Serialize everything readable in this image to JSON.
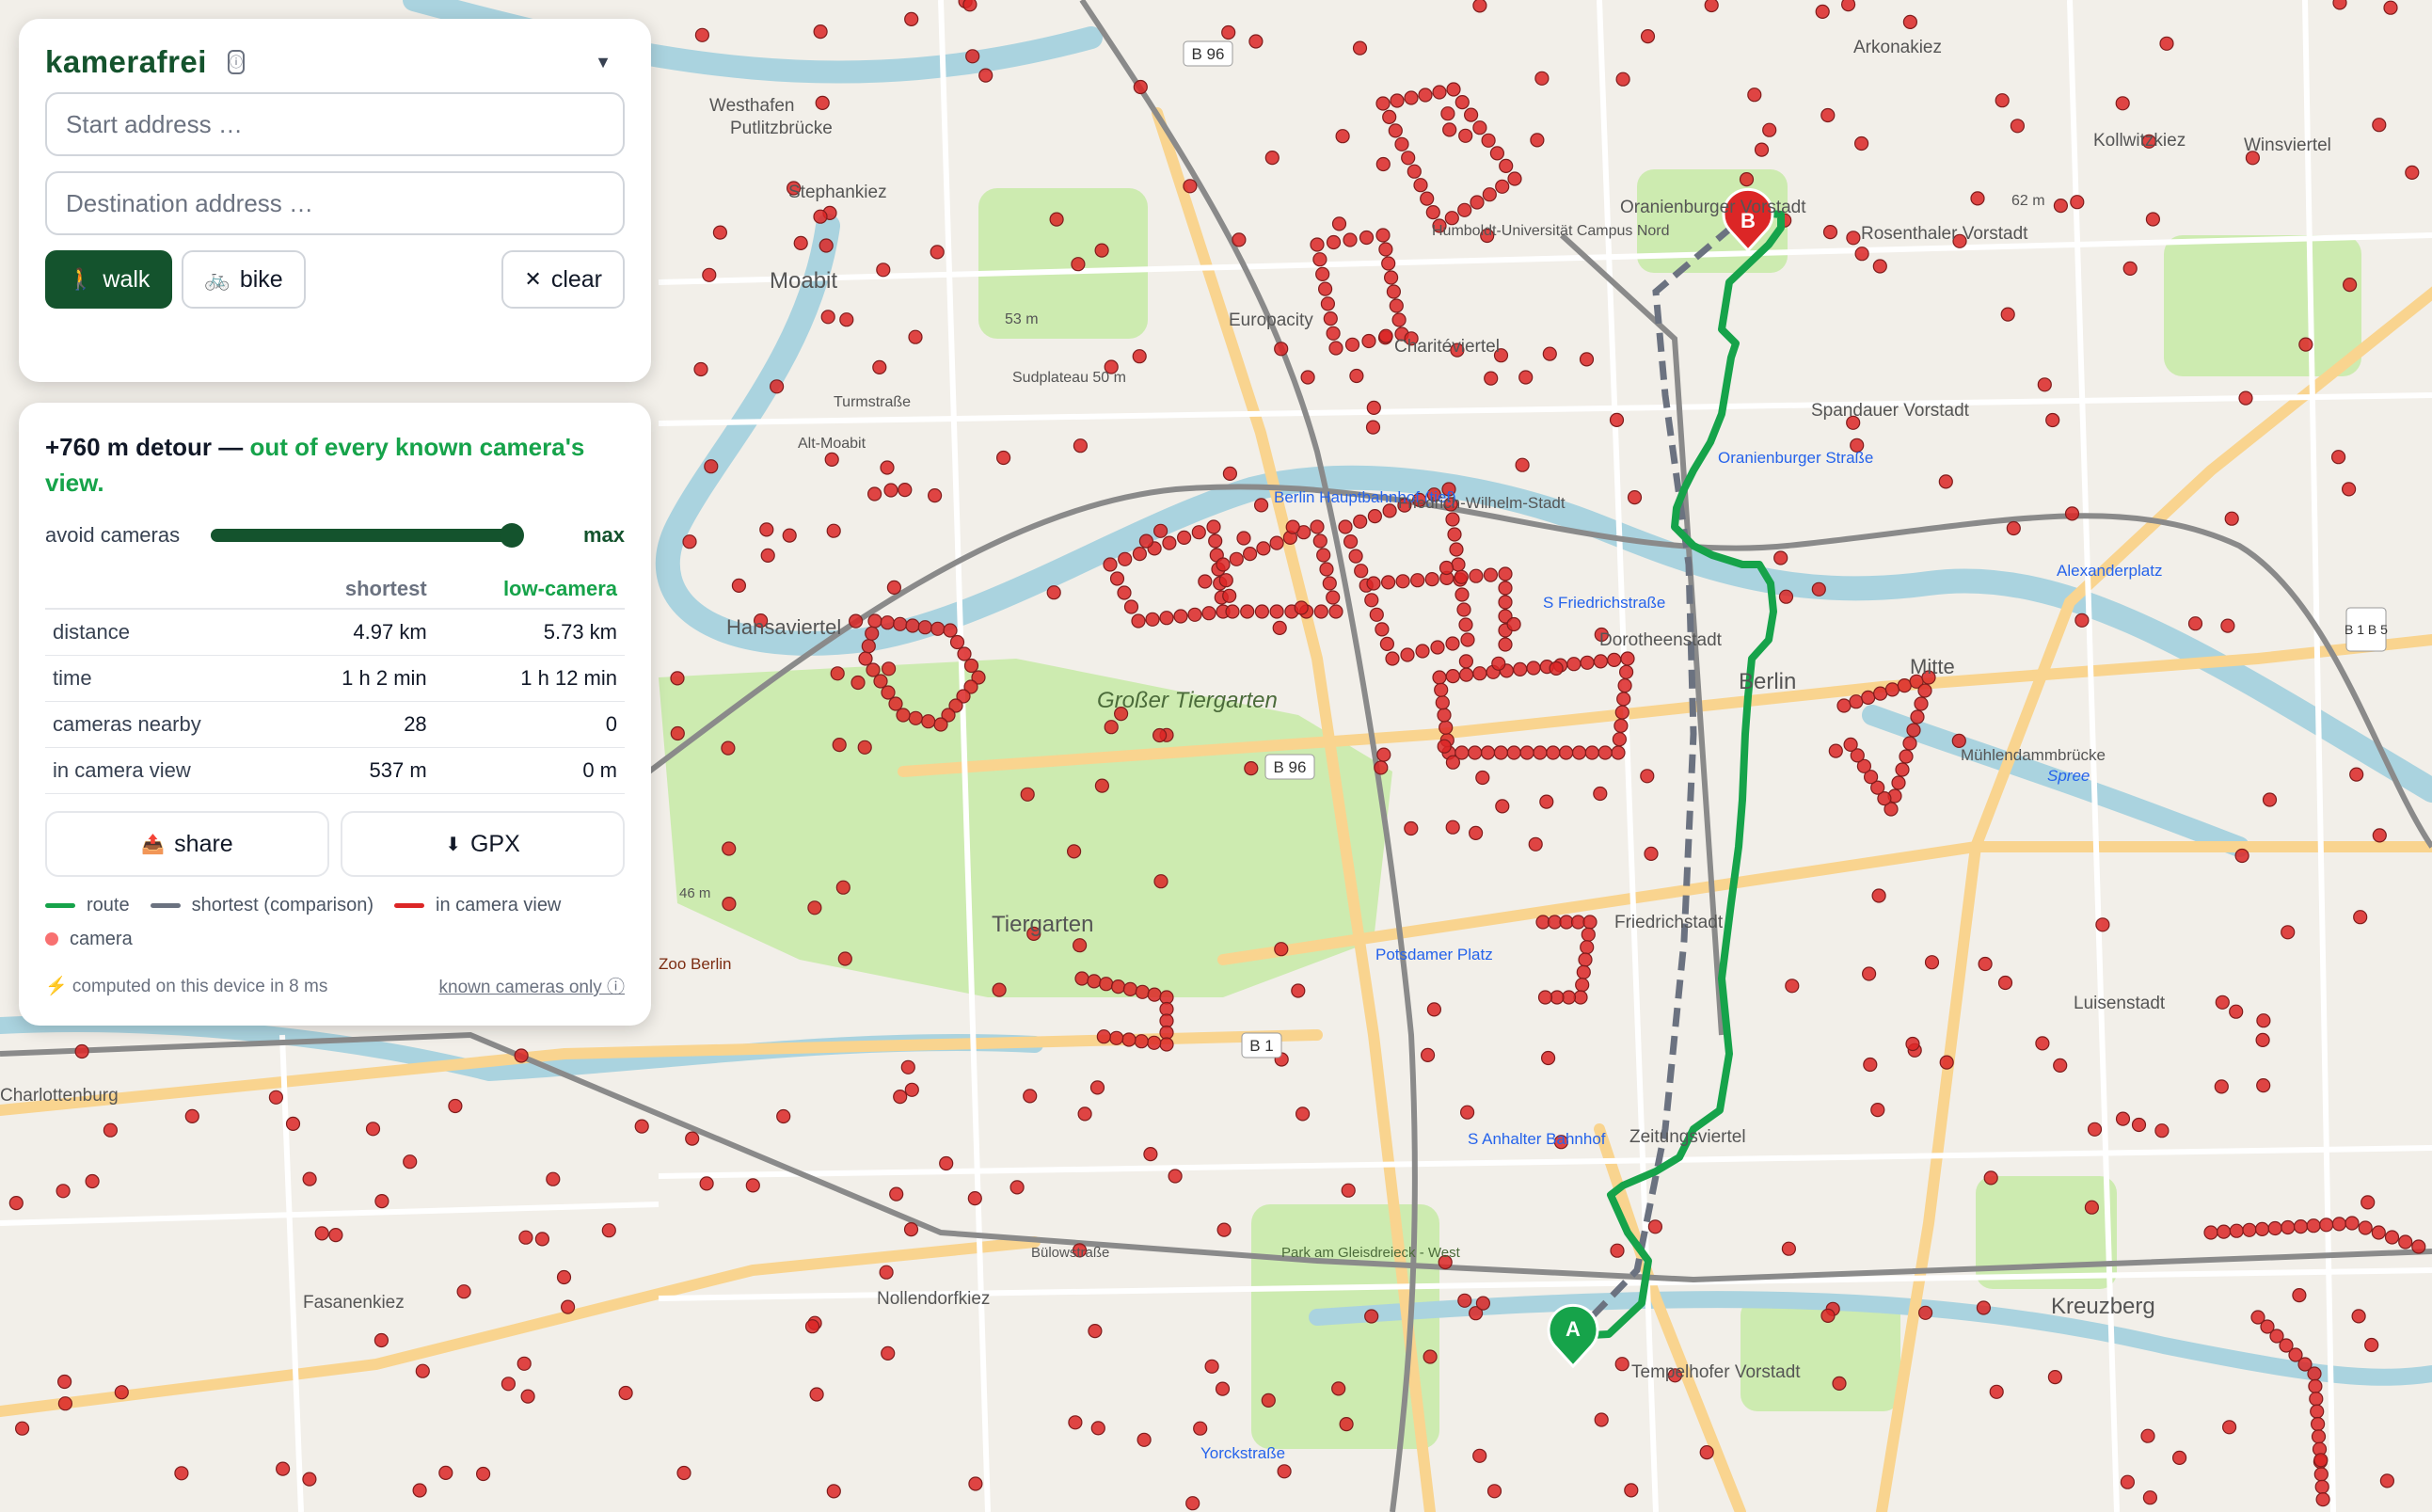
{
  "app": {
    "brand": "kamerafrei",
    "info_icon": "info-icon",
    "menu_icon": "chevron-down-icon"
  },
  "search": {
    "start_placeholder": "Start address …",
    "start_value": "",
    "destination_placeholder": "Destination address …",
    "destination_value": ""
  },
  "modes": {
    "walk_label": "walk",
    "walk_icon": "🚶",
    "bike_label": "bike",
    "bike_icon": "🚲",
    "active": "walk",
    "clear_label": "clear",
    "clear_icon": "✕"
  },
  "result": {
    "headline_prefix": "+760 m detour —",
    "headline_highlight": "out of every known camera's view.",
    "slider_label": "avoid cameras",
    "slider_value_label": "max",
    "slider_level": 1.0,
    "columns": [
      "",
      "shortest",
      "low-camera"
    ],
    "rows": [
      {
        "label": "distance",
        "shortest": "4.97 km",
        "low_camera": "5.73 km"
      },
      {
        "label": "time",
        "shortest": "1 h 2 min",
        "low_camera": "1 h 12 min"
      },
      {
        "label": "cameras nearby",
        "shortest": "28",
        "low_camera": "0"
      },
      {
        "label": "in camera view",
        "shortest": "537 m",
        "low_camera": "0 m"
      }
    ],
    "share_label": "share",
    "share_icon": "📤",
    "gpx_label": "GPX",
    "gpx_icon": "⬇",
    "legend": [
      {
        "label": "route",
        "kind": "line",
        "color": "#16a34a"
      },
      {
        "label": "shortest (comparison)",
        "kind": "line",
        "color": "#6b7280"
      },
      {
        "label": "in camera view",
        "kind": "line",
        "color": "#dc2626"
      },
      {
        "label": "camera",
        "kind": "dot",
        "color": "#f87171"
      }
    ],
    "footer_note": "⚡ computed on this device in 8 ms",
    "footer_link": "known cameras only ⓘ"
  },
  "map": {
    "labels": [
      "Arkonakiez",
      "Kollwitzkiez",
      "Winsviertel",
      "Westhafen",
      "Putlitzbrücke",
      "Stephankiez",
      "Moabit",
      "Europacity",
      "Humboldt-Universität Campus Nord",
      "Rosenthaler Vorstadt",
      "Oranienburger Vorstadt",
      "Charitéviertel",
      "Spandauer Vorstadt",
      "Sudplateau 50 m",
      "53 m",
      "62 m",
      "Turmstraße",
      "Alt-Moabit",
      "Berlin Hauptbahnhof (tief)",
      "Oranienburger Straße",
      "Alexanderplatz",
      "Hansaviertel",
      "Großer Tiergarten",
      "Friedrich-Wilhelm-Stadt",
      "S Friedrichstraße",
      "Dorotheenstadt",
      "Berlin",
      "Mitte",
      "Mühlendammbrücke",
      "Spree",
      "Tiergarten",
      "Zoo Berlin",
      "Potsdamer Platz",
      "Friedrichstadt",
      "Luisenstadt",
      "Charlottenburg",
      "S Anhalter Bahnhof",
      "Zeitungsviertel",
      "Park am Gleisdreieck - West",
      "Fasanenkiez",
      "Nollendorfkiez",
      "Kreuzberg",
      "Tempelhofer Vorstadt",
      "Yorckstraße",
      "Bülowstraße",
      "46 m"
    ],
    "road_labels": [
      "B 96",
      "B 1",
      "B 1 B 5"
    ],
    "markers": [
      {
        "label": "A",
        "color": "#16a34a"
      },
      {
        "label": "B",
        "color": "#dc2626"
      }
    ],
    "colors": {
      "route": "#16a34a",
      "shortest": "#6b7280",
      "camera": "#dc2626",
      "park": "#c8e6b0",
      "water": "#aad3df"
    }
  }
}
